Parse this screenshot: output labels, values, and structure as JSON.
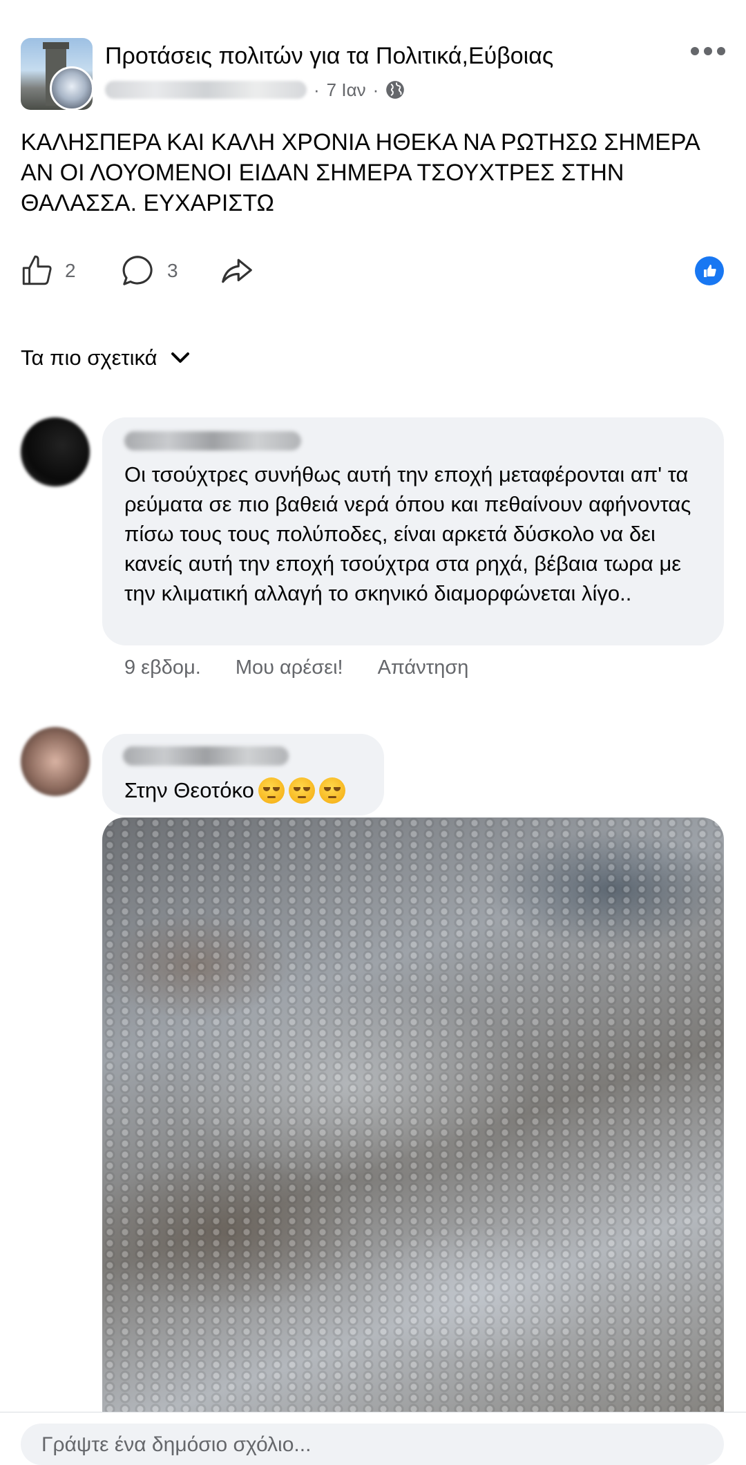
{
  "post": {
    "group_name": "Προτάσεις πολιτών για τα Πολιτικά,Εύβοιας",
    "time": "7 Ιαν",
    "separator": "·",
    "text": "ΚΑΛΗΣΠΕΡΑ ΚΑΙ ΚΑΛΗ ΧΡΟΝΙΑ ΗΘΕΚΑ ΝΑ ΡΩΤΗΣΩ ΣΗΜΕΡΑ ΑΝ ΟΙ ΛΟΥΟΜΕΝΟΙ ΕΙΔΑΝ ΣΗΜΕΡΑ ΤΣΟΥΧΤΡΕΣ ΣΤΗΝ ΘΑΛΑΣΣΑ. ΕΥΧΑΡΙΣΤΩ",
    "likes": "2",
    "comments": "3",
    "privacy_icon": "globe-icon",
    "more_icon": "more-icon"
  },
  "sort": {
    "label": "Τα πιο σχετικά",
    "icon": "chevron-down-icon"
  },
  "comments": [
    {
      "text": "Οι τσούχτρες συνήθως αυτή την εποχή μεταφέρονται απ' τα ρεύματα σε πιο βαθειά νερά όπου και πεθαίνουν αφήνοντας πίσω τους τους πολύποδες, είναι αρκετά δύσκολο να δει κανείς αυτή την εποχή τσούχτρα στα ρηχά, βέβαια τωρα με την κλιματική αλλαγή το σκηνικό διαμορφώνεται λίγο..",
      "time": "9 εβδομ.",
      "like_label": "Μου αρέσει!",
      "reply_label": "Απάντηση"
    },
    {
      "text": "Στην Θεοτόκο",
      "emoji": "face-with-rolling-eyes-emoji"
    }
  ],
  "composer": {
    "placeholder": "Γράψτε ένα δημόσιο σχόλιο..."
  },
  "colors": {
    "accent": "#1877f2",
    "bubble": "#f0f2f5",
    "secondary_text": "#65676b"
  }
}
